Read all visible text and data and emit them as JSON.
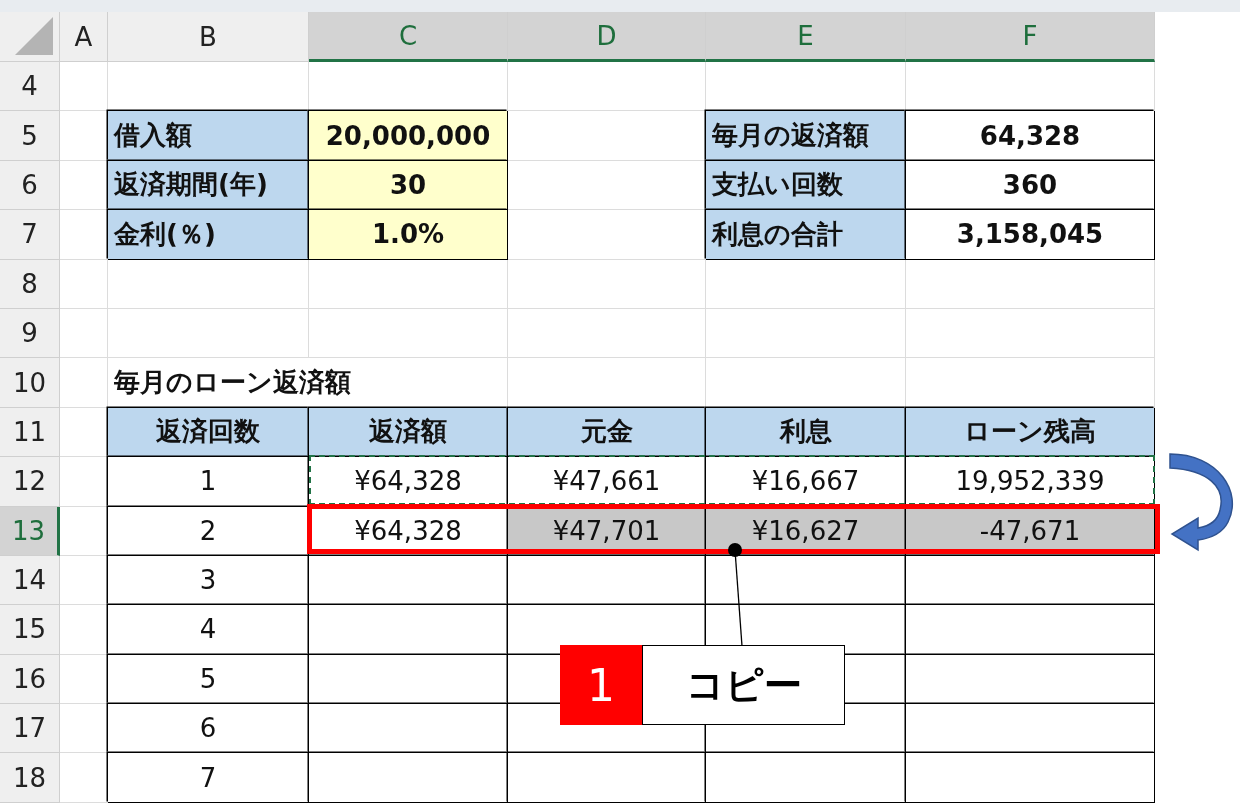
{
  "columns": [
    {
      "label": "A",
      "selected": false
    },
    {
      "label": "B",
      "selected": false
    },
    {
      "label": "C",
      "selected": true
    },
    {
      "label": "D",
      "selected": true
    },
    {
      "label": "E",
      "selected": true
    },
    {
      "label": "F",
      "selected": true
    }
  ],
  "rows": [
    {
      "number": "4",
      "selected": false,
      "cells": [
        {
          "kind": "empty",
          "selected": false
        },
        {
          "kind": "empty",
          "selected": false
        },
        {
          "kind": "empty",
          "selected": false
        },
        {
          "kind": "empty",
          "selected": false
        },
        {
          "kind": "empty",
          "selected": false
        },
        {
          "kind": "empty",
          "selected": false
        }
      ]
    },
    {
      "number": "5",
      "selected": false,
      "cells": [
        {
          "kind": "empty",
          "selected": false
        },
        {
          "kind": "label",
          "text": "借入額",
          "selected": false
        },
        {
          "kind": "input",
          "text": "20,000,000",
          "selected": false
        },
        {
          "kind": "empty",
          "selected": false
        },
        {
          "kind": "label",
          "text": "毎月の返済額",
          "selected": false
        },
        {
          "kind": "output",
          "text": "64,328",
          "selected": false
        }
      ]
    },
    {
      "number": "6",
      "selected": false,
      "cells": [
        {
          "kind": "empty",
          "selected": false
        },
        {
          "kind": "label",
          "text": "返済期間(年)",
          "selected": false
        },
        {
          "kind": "input",
          "text": "30",
          "selected": false
        },
        {
          "kind": "empty",
          "selected": false
        },
        {
          "kind": "label",
          "text": "支払い回数",
          "selected": false
        },
        {
          "kind": "output",
          "text": "360",
          "selected": false
        }
      ]
    },
    {
      "number": "7",
      "selected": false,
      "cells": [
        {
          "kind": "empty",
          "selected": false
        },
        {
          "kind": "label",
          "text": "金利(％)",
          "selected": false
        },
        {
          "kind": "input",
          "text": "1.0%",
          "selected": false
        },
        {
          "kind": "empty",
          "selected": false
        },
        {
          "kind": "label",
          "text": "利息の合計",
          "selected": false
        },
        {
          "kind": "output",
          "text": "3,158,045",
          "selected": false
        }
      ]
    },
    {
      "number": "8",
      "selected": false,
      "cells": [
        {
          "kind": "empty",
          "selected": false
        },
        {
          "kind": "empty",
          "selected": false
        },
        {
          "kind": "empty",
          "selected": false
        },
        {
          "kind": "empty",
          "selected": false
        },
        {
          "kind": "empty",
          "selected": false
        },
        {
          "kind": "empty",
          "selected": false
        }
      ]
    },
    {
      "number": "9",
      "selected": false,
      "cells": [
        {
          "kind": "empty",
          "selected": false
        },
        {
          "kind": "empty",
          "selected": false
        },
        {
          "kind": "empty",
          "selected": false
        },
        {
          "kind": "empty",
          "selected": false
        },
        {
          "kind": "empty",
          "selected": false
        },
        {
          "kind": "empty",
          "selected": false
        }
      ]
    },
    {
      "number": "10",
      "selected": false,
      "cells": [
        {
          "kind": "empty",
          "selected": false
        },
        {
          "kind": "title",
          "text": "毎月のローン返済額",
          "selected": false
        },
        {
          "kind": "empty",
          "selected": false
        },
        {
          "kind": "empty",
          "selected": false
        },
        {
          "kind": "empty",
          "selected": false
        }
      ]
    },
    {
      "number": "11",
      "selected": false,
      "cells": [
        {
          "kind": "empty",
          "selected": false
        },
        {
          "kind": "header",
          "text": "返済回数",
          "selected": false
        },
        {
          "kind": "header",
          "text": "返済額",
          "selected": false
        },
        {
          "kind": "header",
          "text": "元金",
          "selected": false
        },
        {
          "kind": "header",
          "text": "利息",
          "selected": false
        },
        {
          "kind": "header",
          "text": "ローン残高",
          "selected": false
        }
      ]
    },
    {
      "number": "12",
      "selected": false,
      "cells": [
        {
          "kind": "empty",
          "selected": false
        },
        {
          "kind": "value",
          "text": "1",
          "selected": false
        },
        {
          "kind": "value",
          "text": "¥64,328",
          "selected": false
        },
        {
          "kind": "value",
          "text": "¥47,661",
          "selected": false
        },
        {
          "kind": "value",
          "text": "¥16,667",
          "selected": false
        },
        {
          "kind": "value",
          "text": "19,952,339",
          "selected": false
        }
      ]
    },
    {
      "number": "13",
      "selected": true,
      "cells": [
        {
          "kind": "empty",
          "selected": false
        },
        {
          "kind": "value",
          "text": "2",
          "selected": false
        },
        {
          "kind": "value",
          "text": "¥64,328",
          "selected": false
        },
        {
          "kind": "value",
          "text": "¥47,701",
          "selected": true
        },
        {
          "kind": "value",
          "text": "¥16,627",
          "selected": true
        },
        {
          "kind": "value",
          "text": "-47,671",
          "selected": true
        }
      ]
    },
    {
      "number": "14",
      "selected": false,
      "cells": [
        {
          "kind": "empty",
          "selected": false
        },
        {
          "kind": "value",
          "text": "3",
          "selected": false
        },
        {
          "kind": "value",
          "selected": false
        },
        {
          "kind": "value",
          "selected": false
        },
        {
          "kind": "value",
          "selected": false
        },
        {
          "kind": "value",
          "selected": false
        }
      ]
    },
    {
      "number": "15",
      "selected": false,
      "cells": [
        {
          "kind": "empty",
          "selected": false
        },
        {
          "kind": "value",
          "text": "4",
          "selected": false
        },
        {
          "kind": "value",
          "selected": false
        },
        {
          "kind": "value",
          "selected": false
        },
        {
          "kind": "value",
          "selected": false
        },
        {
          "kind": "value",
          "selected": false
        }
      ]
    },
    {
      "number": "16",
      "selected": false,
      "cells": [
        {
          "kind": "empty",
          "selected": false
        },
        {
          "kind": "value",
          "text": "5",
          "selected": false
        },
        {
          "kind": "value",
          "selected": false
        },
        {
          "kind": "value",
          "selected": false
        },
        {
          "kind": "value",
          "selected": false
        },
        {
          "kind": "value",
          "selected": false
        }
      ]
    },
    {
      "number": "17",
      "selected": false,
      "cells": [
        {
          "kind": "empty",
          "selected": false
        },
        {
          "kind": "value",
          "text": "6",
          "selected": false
        },
        {
          "kind": "value",
          "selected": false
        },
        {
          "kind": "value",
          "selected": false
        },
        {
          "kind": "value",
          "selected": false
        },
        {
          "kind": "value",
          "selected": false
        }
      ]
    },
    {
      "number": "18",
      "selected": false,
      "cells": [
        {
          "kind": "empty",
          "selected": false
        },
        {
          "kind": "value",
          "text": "7",
          "selected": false
        },
        {
          "kind": "value",
          "selected": false
        },
        {
          "kind": "value",
          "selected": false
        },
        {
          "kind": "value",
          "selected": false
        },
        {
          "kind": "value",
          "selected": false
        }
      ]
    }
  ],
  "callout": {
    "number": "1",
    "text": "コピー"
  }
}
